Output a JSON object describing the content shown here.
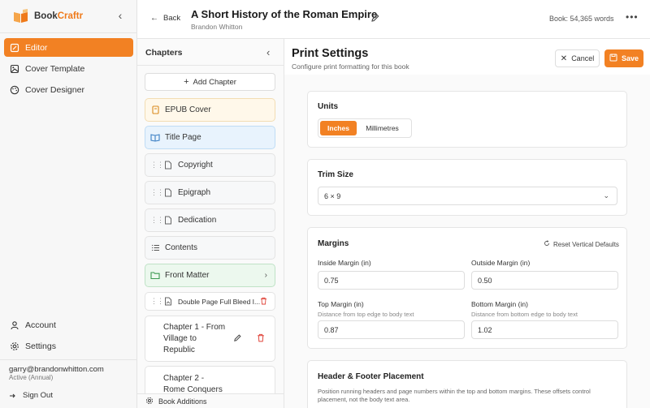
{
  "app": {
    "logo_text_1": "Book",
    "logo_text_2": "Craftr",
    "brand_color": "#f28123"
  },
  "sidebar": {
    "collapse_icon": "chevron-left-icon",
    "nav": [
      {
        "label": "Editor",
        "icon": "pencil-square-icon",
        "active": true
      },
      {
        "label": "Cover Template",
        "icon": "image-icon",
        "active": false
      },
      {
        "label": "Cover Designer",
        "icon": "palette-icon",
        "active": false
      }
    ],
    "bottom_nav": [
      {
        "label": "Account",
        "icon": "user-icon"
      },
      {
        "label": "Settings",
        "icon": "gear-icon"
      }
    ],
    "user_email": "garry@brandonwhitton.com",
    "user_status": "Active (Annual)",
    "sign_out": "Sign Out"
  },
  "header": {
    "back_label": "Back",
    "book_title": "A Short History of the Roman Empire",
    "author": "Brandon Whitton",
    "word_count": "Book: 54,365 words",
    "more_label": "•••"
  },
  "chapters": {
    "title": "Chapters",
    "add_label": "Add Chapter",
    "items": [
      {
        "label": "EPUB Cover",
        "icon": "book-icon",
        "variant": "epub"
      },
      {
        "label": "Title Page",
        "icon": "open-book-icon",
        "variant": "title-pg"
      },
      {
        "label": "Copyright",
        "icon": "file-icon",
        "variant": "plain"
      },
      {
        "label": "Epigraph",
        "icon": "file-icon",
        "variant": "plain"
      },
      {
        "label": "Dedication",
        "icon": "file-icon",
        "variant": "plain"
      },
      {
        "label": "Contents",
        "icon": "list-icon",
        "variant": "plain"
      },
      {
        "label": "Front Matter",
        "icon": "folder-icon",
        "variant": "front"
      },
      {
        "label": "Double Page Full Bleed I...",
        "icon": "image-file-icon",
        "variant": "plain"
      },
      {
        "line1": "Chapter 1 - From",
        "line2": "Village to",
        "line3": "Republic"
      },
      {
        "line1": "Chapter 2 -",
        "line2": "Rome Conquers"
      }
    ],
    "book_additions": "Book Additions"
  },
  "print_settings": {
    "title": "Print Settings",
    "subtitle": "Configure print formatting for this book",
    "cancel_label": "Cancel",
    "save_label": "Save",
    "units": {
      "title": "Units",
      "options": [
        "Inches",
        "Millimetres"
      ],
      "selected": "Inches"
    },
    "trim": {
      "title": "Trim Size",
      "value": "6 × 9"
    },
    "margins": {
      "title": "Margins",
      "reset_label": "Reset Vertical Defaults",
      "inside_label": "Inside Margin (in)",
      "inside_value": "0.75",
      "outside_label": "Outside Margin (in)",
      "outside_value": "0.50",
      "top_label": "Top Margin (in)",
      "top_hint": "Distance from top edge to body text",
      "top_value": "0.87",
      "bottom_label": "Bottom Margin (in)",
      "bottom_hint": "Distance from bottom edge to body text",
      "bottom_value": "1.02"
    },
    "header_footer": {
      "title": "Header & Footer Placement",
      "description": "Position running headers and page numbers within the top and bottom margins. These offsets control placement, not the body text area."
    }
  }
}
